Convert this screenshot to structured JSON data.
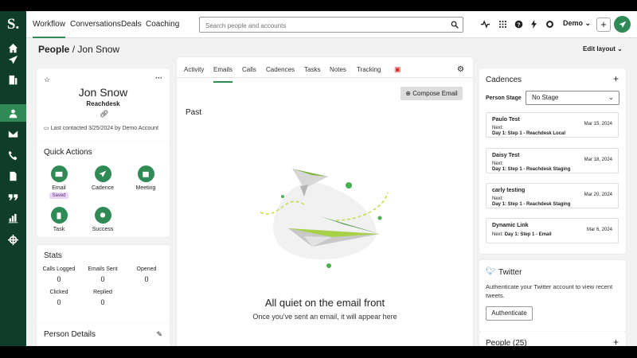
{
  "app": {
    "logo": "S.",
    "brand_color": "#2f8a55",
    "rail_color": "#0f3d2a"
  },
  "rail": [
    "home-icon",
    "rocket-icon",
    "building-icon",
    "person-icon",
    "mail-icon",
    "phone-icon",
    "document-icon",
    "quote-icon",
    "chart-icon",
    "crosshair-icon"
  ],
  "topnav": {
    "workflow": "Workflow",
    "conversations": "Conversations",
    "deals": "Deals",
    "coaching": "Coaching"
  },
  "search": {
    "placeholder": "Search people and accounts"
  },
  "account": {
    "label": "Demo"
  },
  "header": {
    "title": "People",
    "sep": "/",
    "name": "Jon Snow",
    "edit_layout": "Edit layout"
  },
  "profile": {
    "name": "Jon Snow",
    "company": "Reachdesk",
    "last_contacted": "Last contacted 3/25/2024 by Demo Account"
  },
  "quick_actions": {
    "title": "Quick Actions",
    "email": "Email",
    "saved": "Saved",
    "cadence": "Cadence",
    "meeting": "Meeting",
    "task": "Task",
    "success": "Success"
  },
  "stats": {
    "title": "Stats",
    "calls_logged_label": "Calls Logged",
    "calls_logged": "0",
    "emails_sent_label": "Emails Sent",
    "emails_sent": "0",
    "opened_label": "Opened",
    "opened": "0",
    "clicked_label": "Clicked",
    "clicked": "0",
    "replied_label": "Replied",
    "replied": "0"
  },
  "person_details": {
    "title": "Person Details"
  },
  "tabs": {
    "activity": "Activity",
    "emails": "Emails",
    "calls": "Calls",
    "cadences": "Cadences",
    "tasks": "Tasks",
    "notes": "Notes",
    "tracking": "Tracking"
  },
  "emails": {
    "compose": "Compose Email",
    "past": "Past",
    "empty_title": "All quiet on the email front",
    "empty_sub": "Once you've sent an email, it will appear here"
  },
  "cadences": {
    "title": "Cadences",
    "stage_label": "Person Stage",
    "stage_value": "No Stage",
    "items": [
      {
        "name": "Paulo Test",
        "date": "Mar 15, 2024",
        "next": "Next:",
        "step": "Day 1: Step 1 - Reachdesk Local"
      },
      {
        "name": "Daisy Test",
        "date": "Mar 18, 2024",
        "next": "Next:",
        "step": "Day 1: Step 1 - Reachdesk Staging"
      },
      {
        "name": "carly testing",
        "date": "Mar 20, 2024",
        "next": "Next:",
        "step": "Day 1: Step 1 - Reachdesk Staging"
      },
      {
        "name": "Dynamic Link",
        "date": "Mar 6, 2024",
        "next": "Next:",
        "step": "Day 1: Step 1 - Email"
      }
    ]
  },
  "twitter": {
    "title": "Twitter",
    "desc": "Authenticate your Twitter account to view recent tweets.",
    "button": "Authenticate"
  },
  "people": {
    "title": "People (25)"
  }
}
